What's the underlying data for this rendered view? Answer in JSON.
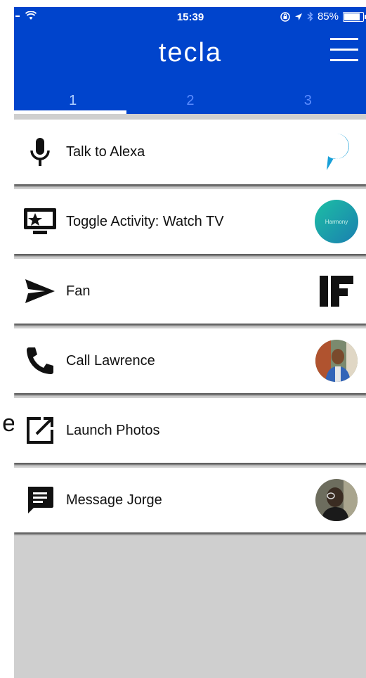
{
  "stray": {
    "text": "e"
  },
  "status_bar": {
    "time": "15:39",
    "battery": "85%",
    "battery_level": 0.85
  },
  "header": {
    "title": "tecla"
  },
  "tabs": [
    {
      "label": "1",
      "active": true
    },
    {
      "label": "2",
      "active": false
    },
    {
      "label": "3",
      "active": false
    }
  ],
  "rows": [
    {
      "label": "Talk to Alexa",
      "icon": "microphone-icon",
      "brand": "alexa-logo"
    },
    {
      "label": "Toggle Activity: Watch TV",
      "icon": "tv-activity-icon",
      "brand": "harmony-logo",
      "brand_text": "Harmony"
    },
    {
      "label": "Fan",
      "icon": "send-icon",
      "brand": "ifttt-logo"
    },
    {
      "label": "Call Lawrence",
      "icon": "phone-icon",
      "brand": "contact-avatar-lawrence"
    },
    {
      "label": "Launch Photos",
      "icon": "open-external-icon",
      "brand": ""
    },
    {
      "label": "Message Jorge",
      "icon": "message-icon",
      "brand": "contact-avatar-jorge"
    }
  ],
  "colors": {
    "header_bg": "#0044cc",
    "list_bg": "#cfcfcf",
    "tab_active": "#aed0ff",
    "tab_inactive": "#5a8cff"
  }
}
